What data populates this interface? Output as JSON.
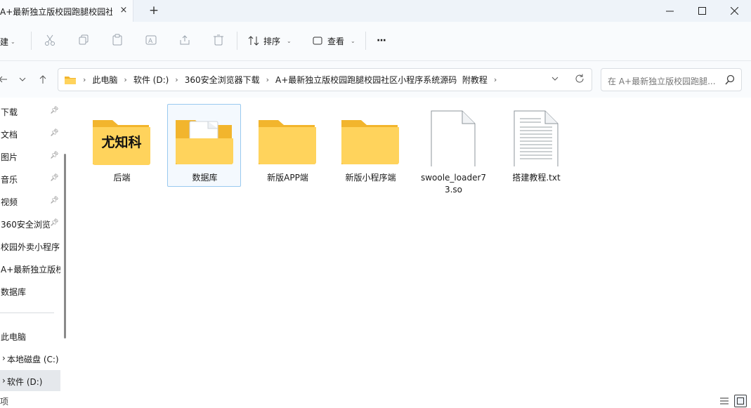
{
  "window": {
    "tab_title": "A+最新独立版校园跑腿校园社",
    "tab_close": "×",
    "tab_add": "+"
  },
  "toolbar": {
    "new_label": "新建",
    "sort_label": "排序",
    "view_label": "查看",
    "more_label": "···"
  },
  "address": {
    "breadcrumbs": [
      "此电脑",
      "软件 (D:)",
      "360安全浏览器下载",
      "A+最新独立版校园跑腿校园社区小程序系统源码  附教程"
    ],
    "search_placeholder": "在 A+最新独立版校园跑腿..."
  },
  "sidebar": {
    "quick": [
      {
        "label": "下载",
        "pinned": true
      },
      {
        "label": "文档",
        "pinned": true
      },
      {
        "label": "图片",
        "pinned": true
      },
      {
        "label": "音乐",
        "pinned": true
      },
      {
        "label": "视频",
        "pinned": true
      },
      {
        "label": "360安全浏览",
        "pinned": true
      },
      {
        "label": "校园外卖小程序",
        "pinned": false
      },
      {
        "label": "A+最新独立版校",
        "pinned": false
      },
      {
        "label": "数据库",
        "pinned": false
      }
    ],
    "pc_label": "此电脑",
    "drives": [
      {
        "label": "本地磁盘 (C:)",
        "selected": false
      },
      {
        "label": "软件 (D:)",
        "selected": true
      }
    ]
  },
  "files": [
    {
      "name": "后端",
      "type": "folder-thumb",
      "thumb_text": "尤知科"
    },
    {
      "name": "数据库",
      "type": "folder-doc",
      "selected": true
    },
    {
      "name": "新版APP端",
      "type": "folder"
    },
    {
      "name": "新版小程序端",
      "type": "folder"
    },
    {
      "name": "swoole_loader73.so",
      "type": "file"
    },
    {
      "name": "搭建教程.txt",
      "type": "text-file"
    }
  ],
  "status": {
    "left_text": "项"
  },
  "colors": {
    "folder_back": "#f2b52d",
    "folder_front": "#ffd35c",
    "selection_border": "#99c9ef",
    "titlebar_bg": "#eef3f9"
  }
}
